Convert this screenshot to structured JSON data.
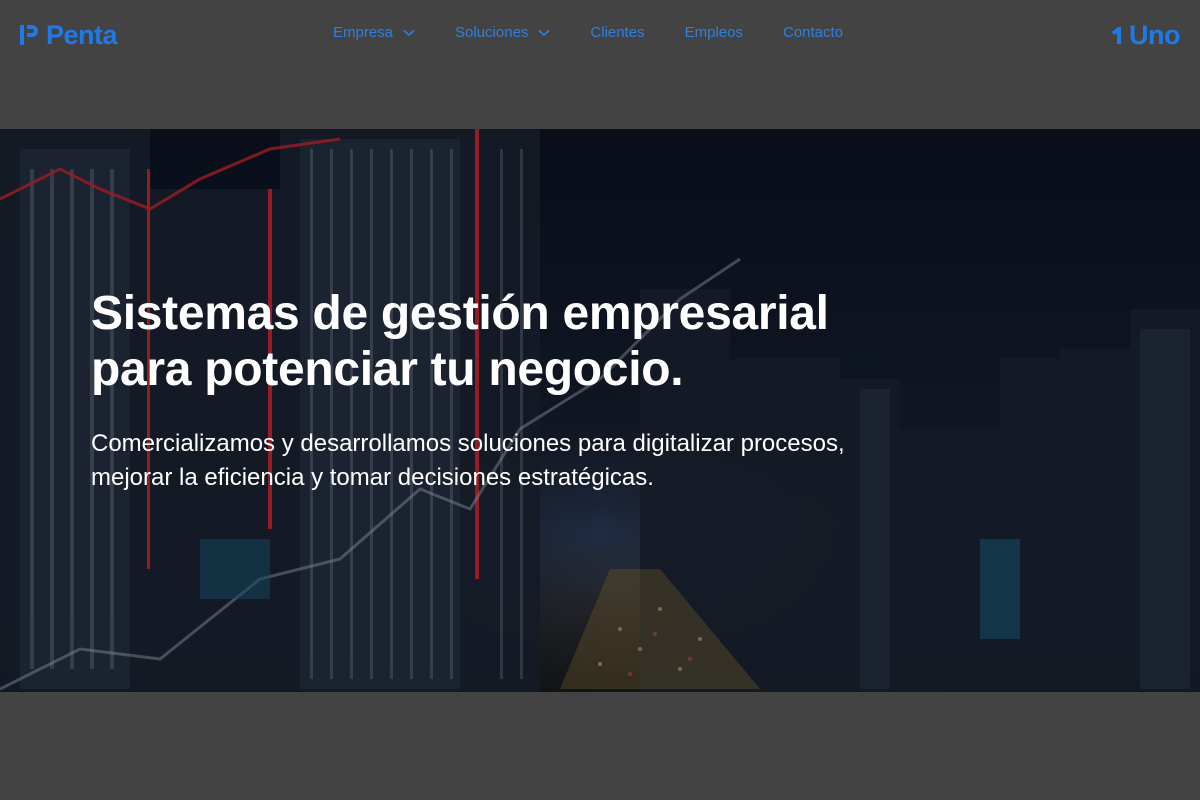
{
  "header": {
    "brand": {
      "name": "Penta",
      "icon": "penta-logo-icon"
    },
    "nav": [
      {
        "label": "Empresa",
        "has_dropdown": true
      },
      {
        "label": "Soluciones",
        "has_dropdown": true
      },
      {
        "label": "Clientes",
        "has_dropdown": false
      },
      {
        "label": "Empleos",
        "has_dropdown": false
      },
      {
        "label": "Contacto",
        "has_dropdown": false
      }
    ],
    "partner": {
      "name": "Uno",
      "icon": "uno-logo-icon"
    }
  },
  "hero": {
    "title_line1": "Sistemas de gestión empresarial",
    "title_line2": "para potenciar tu negocio.",
    "subtitle_line1": "Comercializamos y desarrollamos soluciones para digitalizar procesos,",
    "subtitle_line2": "mejorar la eficiencia y tomar decisiones estratégicas."
  },
  "colors": {
    "background": "#434343",
    "brand_blue": "#1f7ae8",
    "nav_text": "#2f7fe0",
    "hero_text": "#ffffff"
  }
}
